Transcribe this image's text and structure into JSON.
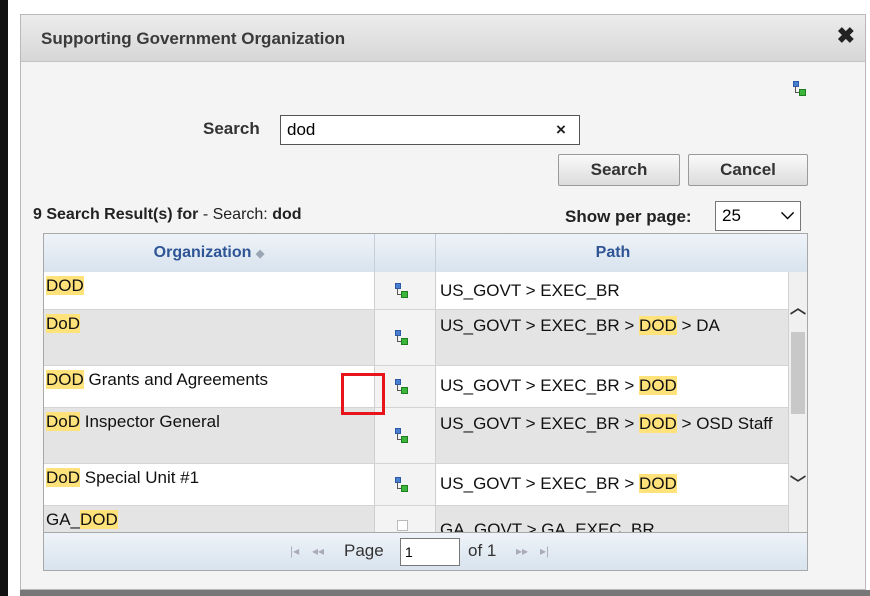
{
  "dialog": {
    "title": "Supporting Government Organization"
  },
  "search": {
    "label": "Search",
    "value": "dod",
    "clear_symbol": "×",
    "search_button": "Search",
    "cancel_button": "Cancel"
  },
  "results": {
    "summary_prefix": "9 Search Result(s) for",
    "summary_mid": " - Search: ",
    "summary_term": "dod",
    "per_page_label": "Show per page:",
    "per_page_value": "25"
  },
  "grid": {
    "columns": [
      {
        "label": "Organization",
        "sort_icon": "sort-icon"
      },
      {
        "label": ""
      },
      {
        "label": "Path"
      }
    ],
    "rows": [
      {
        "org_hl": "DOD",
        "org_rest": "",
        "path_pre": "US_GOVT > EXEC_BR",
        "path_hl": "",
        "path_post": ""
      },
      {
        "org_hl": "DoD",
        "org_rest": "",
        "path_pre": "US_GOVT > EXEC_BR > ",
        "path_hl": "DOD",
        "path_post": " > DA"
      },
      {
        "org_hl": "DOD",
        "org_rest": " Grants and Agreements",
        "path_pre": "US_GOVT > EXEC_BR > ",
        "path_hl": "DOD",
        "path_post": ""
      },
      {
        "org_hl": "DoD",
        "org_rest": " Inspector General",
        "path_pre": "US_GOVT > EXEC_BR > ",
        "path_hl": "DOD",
        "path_post": " > OSD Staff"
      },
      {
        "org_hl": "DoD",
        "org_rest": " Special Unit #1",
        "path_pre": "US_GOVT > EXEC_BR > ",
        "path_hl": "DOD",
        "path_post": ""
      },
      {
        "org_pre": "GA_",
        "org_hl": "DOD",
        "org_rest": "",
        "path_pre": "GA_GOVT > GA_EXEC_BR",
        "path_hl": "",
        "path_post": ""
      }
    ]
  },
  "pager": {
    "first": "|◂",
    "prev": "◂◂",
    "page_label": "Page",
    "page_value": "1",
    "of_label": "of 1",
    "next": "▸▸",
    "last": "▸|"
  },
  "colors": {
    "highlight": "#ffe27a",
    "header_text": "#2f5597",
    "callout": "#e8141c"
  }
}
